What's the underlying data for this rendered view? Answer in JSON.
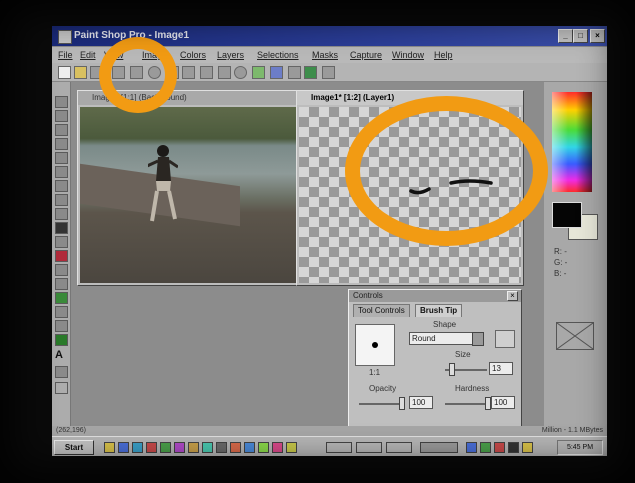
{
  "app": {
    "title": "Paint Shop Pro - Image1",
    "window_buttons": [
      "_",
      "□",
      "×"
    ]
  },
  "menu": [
    "File",
    "Edit",
    "View",
    "Image",
    "Colors",
    "Layers",
    "Selections",
    "Masks",
    "Capture",
    "Window",
    "Help"
  ],
  "documents": {
    "photo": {
      "title": "Image2 [1:1] (Background)"
    },
    "canvas": {
      "title": "Image1* [1:2] (Layer1)"
    }
  },
  "controls": {
    "title": "Controls",
    "tabs": [
      "Tool Controls",
      "Brush Tip"
    ],
    "shape_label": "Shape",
    "shape_value": "Round",
    "size_label": "Size",
    "size_value": "13",
    "ratio": "1:1",
    "opacity_label": "Opacity",
    "opacity_value": "100",
    "hardness_label": "Hardness",
    "hardness_value": "100"
  },
  "color_panel": {
    "r": "R: -",
    "g": "G: -",
    "b": "B: -"
  },
  "status": {
    "coords": "(262,196)",
    "memory": "Million - 1.1 MBytes"
  },
  "taskbar": {
    "start": "Start",
    "clock": "5:45 PM"
  },
  "annotation_color": "#f29b13"
}
